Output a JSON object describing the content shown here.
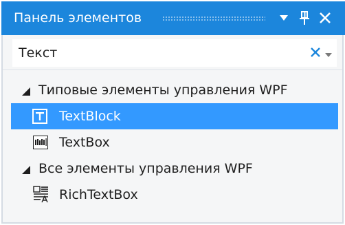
{
  "panel": {
    "title": "Панель элементов",
    "colors": {
      "titlebar": "#1c86dc",
      "selection": "#3399ff",
      "background": "#f5f6f7"
    }
  },
  "titlebar_buttons": {
    "menu_icon": "chevron-down-icon",
    "pin_icon": "pin-icon",
    "close_icon": "close-icon"
  },
  "search": {
    "value": "Текст",
    "clear_icon": "clear-icon",
    "dropdown_icon": "chevron-down-icon"
  },
  "tree": {
    "groups": [
      {
        "label": "Типовые элементы управления WPF",
        "expanded": true,
        "items": [
          {
            "label": "TextBlock",
            "icon": "textblock-icon",
            "selected": true
          },
          {
            "label": "TextBox",
            "icon": "textbox-icon",
            "selected": false
          }
        ]
      },
      {
        "label": "Все элементы управления WPF",
        "expanded": true,
        "items": [
          {
            "label": "RichTextBox",
            "icon": "richtextbox-icon",
            "selected": false
          }
        ]
      }
    ]
  }
}
